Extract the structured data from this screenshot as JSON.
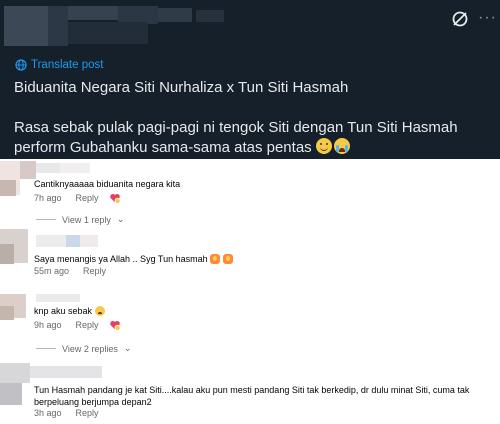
{
  "post": {
    "translate_label": "Translate post",
    "title": "Biduanita Negara Siti Nurhaliza x Tun Siti Hasmah",
    "body": "Rasa sebak pulak pagi-pagi ni tengok Siti dengan Tun Siti Hasmah perform Gubahanku sama-sama atas pentas",
    "icons": [
      "grok-icon",
      "more-icon",
      "translate-icon",
      "smiling-face-emoji",
      "crying-face-emoji"
    ],
    "colors": {
      "background": "#15202b",
      "text": "#e7e9ea",
      "link": "#1d9bf0"
    }
  },
  "comments": [
    {
      "text": "Cantiknyaaaaa biduanita negara kita",
      "time": "7h ago",
      "reply_label": "Reply",
      "reaction": "love-reaction",
      "replies_label": "View 1 reply"
    },
    {
      "text": "Saya menangis ya Allah .. Syg Tun hasmah",
      "time": "55m ago",
      "reply_label": "Reply"
    },
    {
      "text": "knp aku sebak",
      "time": "9h ago",
      "reply_label": "Reply",
      "reaction": "love-reaction",
      "replies_label": "View 2 replies"
    },
    {
      "text": "Tun Hasmah pandang je kat Siti....kalau aku pun mesti pandang Siti tak berkedip, dr dulu minat Siti, cuma tak berpeluang berjumpa depan2",
      "time": "3h ago",
      "reply_label": "Reply"
    }
  ]
}
